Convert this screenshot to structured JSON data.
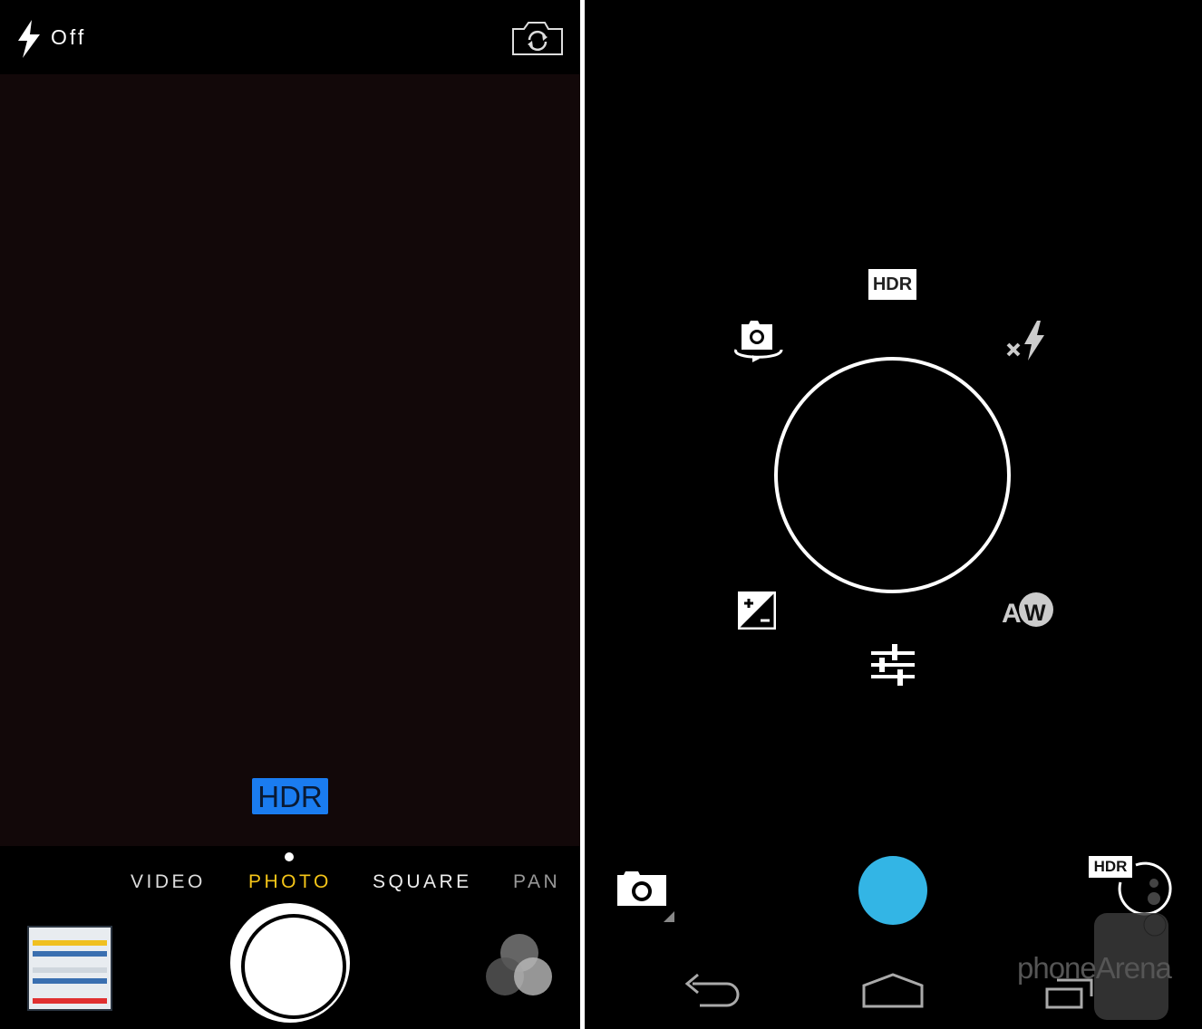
{
  "ios_camera": {
    "flash": {
      "icon": "flash-icon",
      "label": "Off"
    },
    "switch_camera_icon": "camera-switch-icon",
    "hdr_badge": "HDR",
    "modes": [
      "VIDEO",
      "PHOTO",
      "SQUARE",
      "PANO"
    ],
    "selected_mode": "PHOTO",
    "colors": {
      "selected_mode": "#f5c518",
      "hdr_badge": "#1a7cf0"
    }
  },
  "android_camera": {
    "pie_menu": {
      "hdr": "HDR",
      "white_balance": "AW"
    },
    "bottom": {
      "hdr_label": "HDR"
    },
    "nav": [
      "back-icon",
      "home-icon",
      "recents-icon"
    ],
    "colors": {
      "shutter": "#33b5e5"
    }
  },
  "watermark": "phoneArena"
}
